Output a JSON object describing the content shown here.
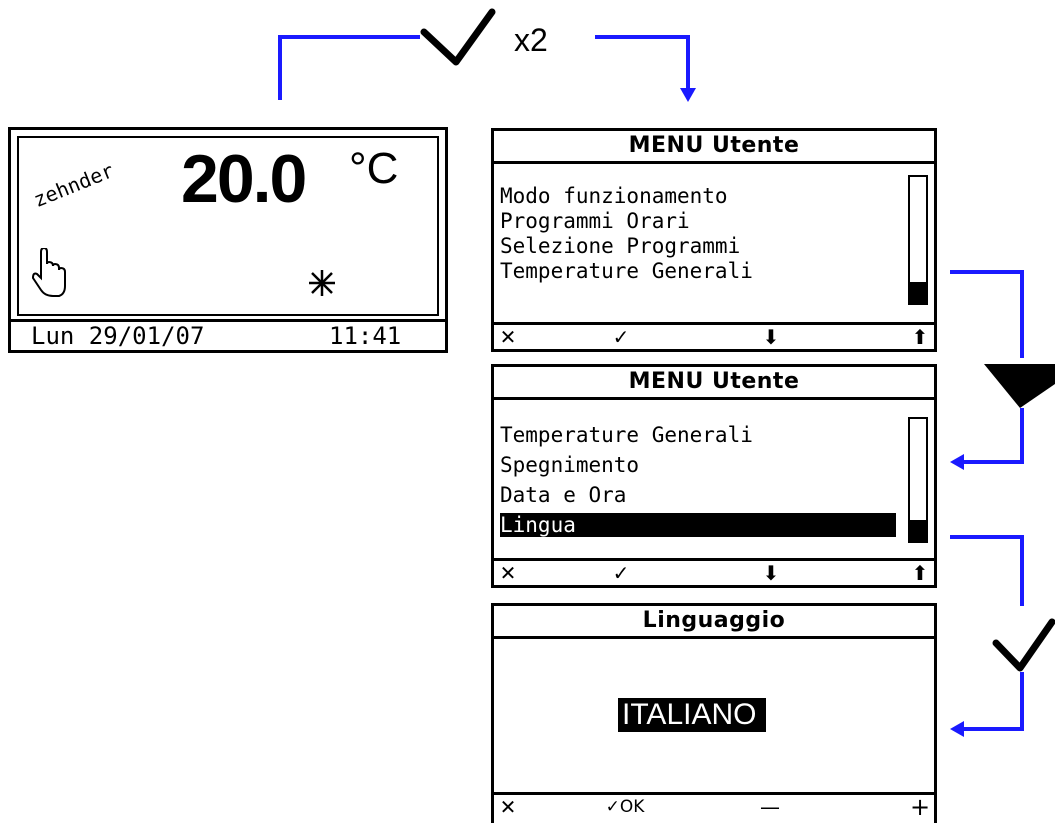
{
  "top_label": {
    "repeat": "x2"
  },
  "home_screen": {
    "brand": "zehnder",
    "temperature": "20.0",
    "unit": "°C",
    "date": "Lun 29/01/07",
    "time": "11:41"
  },
  "menu_screen_1": {
    "title": "MENU Utente",
    "items": [
      {
        "label": "Modo funzionamento",
        "selected": false
      },
      {
        "label": "Programmi Orari",
        "selected": false
      },
      {
        "label": "Selezione Programmi",
        "selected": false
      },
      {
        "label": "Temperature Generali",
        "selected": false
      }
    ],
    "scroll_position": 0.17,
    "softkeys": {
      "cancel": "✕",
      "confirm": "✓",
      "down": "⬇",
      "up": "⬆"
    }
  },
  "menu_screen_2": {
    "title": "MENU Utente",
    "items": [
      {
        "label": "Temperature Generali",
        "selected": false
      },
      {
        "label": "Spegnimento",
        "selected": false
      },
      {
        "label": "Data e Ora",
        "selected": false
      },
      {
        "label": "Lingua",
        "selected": true
      }
    ],
    "scroll_position": 0.17,
    "softkeys": {
      "cancel": "✕",
      "confirm": "✓",
      "down": "⬇",
      "up": "⬆"
    }
  },
  "language_screen": {
    "title": "Linguaggio",
    "value": "ITALIANO",
    "softkeys": {
      "cancel": "✕",
      "confirm": "✓OK",
      "minus": "—",
      "plus": "+"
    }
  },
  "colors": {
    "connector": "#1a1aff",
    "lcd_ink": "#000000",
    "background": "#ffffff"
  },
  "icons": [
    "checkmark-icon",
    "down-triangle-icon",
    "hand-pointer-icon",
    "snowflake-icon"
  ]
}
